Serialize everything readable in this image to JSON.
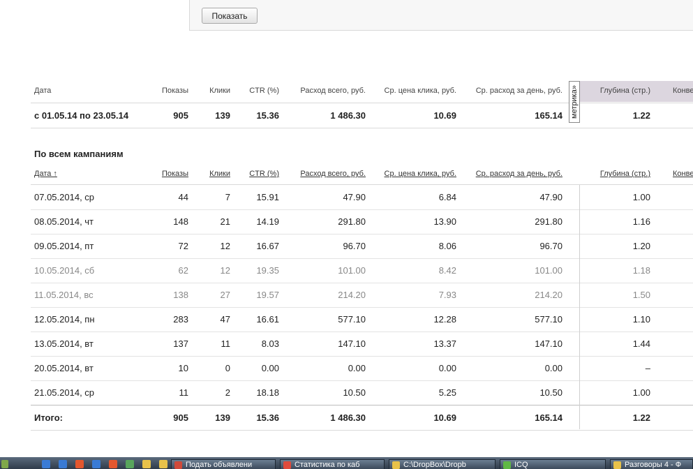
{
  "filter": {
    "show_button": "Показать"
  },
  "columns": {
    "date": "Дата",
    "date_sorted": "Дата ↑",
    "shows": "Показы",
    "clicks": "Клики",
    "ctr": "CTR (%)",
    "spend": "Расход всего, руб.",
    "cpc": "Ср. цена клика, руб.",
    "daily": "Ср. расход за день, руб.",
    "depth": "Глубина (стр.)",
    "conv": "Конве"
  },
  "metrika_tab": "метрика»",
  "summary": {
    "date": "с 01.05.14 по 23.05.14",
    "shows": "905",
    "clicks": "139",
    "ctr": "15.36",
    "spend": "1 486.30",
    "cpc": "10.69",
    "daily": "165.14",
    "depth": "1.22"
  },
  "section_title": "По всем кампаниям",
  "rows": [
    {
      "date": "07.05.2014, ср",
      "shows": "44",
      "clicks": "7",
      "ctr": "15.91",
      "spend": "47.90",
      "cpc": "6.84",
      "daily": "47.90",
      "depth": "1.00",
      "weekend": false
    },
    {
      "date": "08.05.2014, чт",
      "shows": "148",
      "clicks": "21",
      "ctr": "14.19",
      "spend": "291.80",
      "cpc": "13.90",
      "daily": "291.80",
      "depth": "1.16",
      "weekend": false
    },
    {
      "date": "09.05.2014, пт",
      "shows": "72",
      "clicks": "12",
      "ctr": "16.67",
      "spend": "96.70",
      "cpc": "8.06",
      "daily": "96.70",
      "depth": "1.20",
      "weekend": false
    },
    {
      "date": "10.05.2014, сб",
      "shows": "62",
      "clicks": "12",
      "ctr": "19.35",
      "spend": "101.00",
      "cpc": "8.42",
      "daily": "101.00",
      "depth": "1.18",
      "weekend": true
    },
    {
      "date": "11.05.2014, вс",
      "shows": "138",
      "clicks": "27",
      "ctr": "19.57",
      "spend": "214.20",
      "cpc": "7.93",
      "daily": "214.20",
      "depth": "1.50",
      "weekend": true
    },
    {
      "date": "12.05.2014, пн",
      "shows": "283",
      "clicks": "47",
      "ctr": "16.61",
      "spend": "577.10",
      "cpc": "12.28",
      "daily": "577.10",
      "depth": "1.10",
      "weekend": false
    },
    {
      "date": "13.05.2014, вт",
      "shows": "137",
      "clicks": "11",
      "ctr": "8.03",
      "spend": "147.10",
      "cpc": "13.37",
      "daily": "147.10",
      "depth": "1.44",
      "weekend": false
    },
    {
      "date": "20.05.2014, вт",
      "shows": "10",
      "clicks": "0",
      "ctr": "0.00",
      "spend": "0.00",
      "cpc": "0.00",
      "daily": "0.00",
      "depth": "–",
      "weekend": false
    },
    {
      "date": "21.05.2014, ср",
      "shows": "11",
      "clicks": "2",
      "ctr": "18.18",
      "spend": "10.50",
      "cpc": "5.25",
      "daily": "10.50",
      "depth": "1.00",
      "weekend": false
    }
  ],
  "total": {
    "label": "Итого:",
    "shows": "905",
    "clicks": "139",
    "ctr": "15.36",
    "spend": "1 486.30",
    "cpc": "10.69",
    "daily": "165.14",
    "depth": "1.22"
  },
  "taskbar": {
    "buttons": [
      {
        "label": "Подать объявлени",
        "icon_color": "#d04a3a"
      },
      {
        "label": "Статистика по каб",
        "icon_color": "#e04b3c"
      },
      {
        "label": "C:\\DropBox\\Dropb",
        "icon_color": "#e8c24a"
      },
      {
        "label": "ICQ",
        "icon_color": "#5fb845"
      },
      {
        "label": "Разговоры 4 - Ф",
        "icon_color": "#e8c24a"
      }
    ],
    "quick_icons": [
      "#3a7bd5",
      "#3a7bd5",
      "#e4572e",
      "#3a7bd5",
      "#e4572e",
      "#58a55c",
      "#e8c24a",
      "#e8c24a"
    ]
  }
}
